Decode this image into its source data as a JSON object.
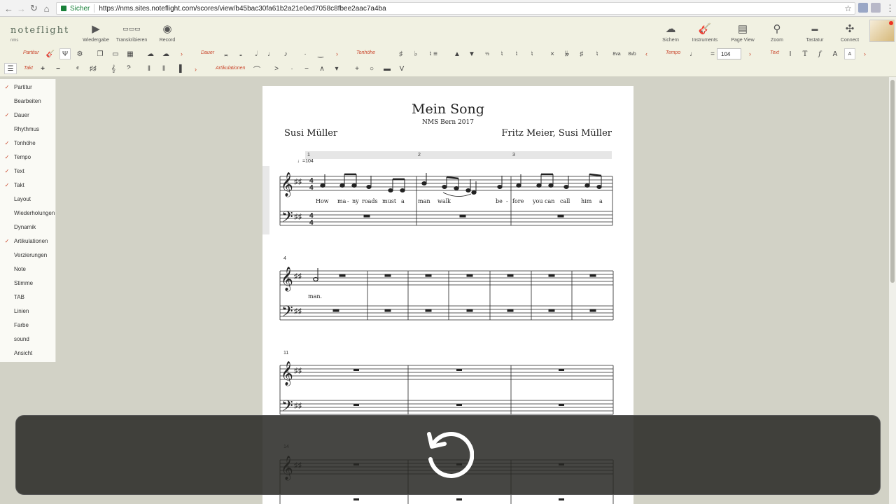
{
  "browser": {
    "secure_label": "Sicher",
    "url": "https://nms.sites.noteflight.com/scores/view/b45bac30fa61b2a21e0ed7058c8fbee2aac7a4ba"
  },
  "header": {
    "logo": "noteflight",
    "logo_sub": "nms",
    "buttons": {
      "playback": "Wiedergabe",
      "transcribe": "Transkribieren",
      "record": "Record",
      "save": "Sichern",
      "instruments": "Instruments",
      "page_view": "Page View",
      "zoom": "Zoom",
      "keyboard": "Tastatur",
      "connect": "Connect"
    }
  },
  "toolbar": {
    "labels": {
      "score": "Partitur",
      "duration": "Dauer",
      "pitch": "Tonhöhe",
      "tempo": "Tempo",
      "text": "Text",
      "measure": "Takt",
      "articulations": "Artikulationen"
    },
    "tempo_value": "104",
    "tempo_eq": "=",
    "text_tools": [
      "I",
      "T",
      "f",
      "A"
    ]
  },
  "leftmenu": {
    "items": [
      {
        "label": "Partitur",
        "checked": "✓"
      },
      {
        "label": "Bearbeiten",
        "checked": ""
      },
      {
        "label": "Dauer",
        "checked": "✓"
      },
      {
        "label": "Rhythmus",
        "checked": ""
      },
      {
        "label": "Tonhöhe",
        "checked": "✓"
      },
      {
        "label": "Tempo",
        "checked": "✓"
      },
      {
        "label": "Text",
        "checked": "✓"
      },
      {
        "label": "Takt",
        "checked": "✓"
      },
      {
        "label": "Layout",
        "checked": ""
      },
      {
        "label": "Wiederholungen",
        "checked": ""
      },
      {
        "label": "Dynamik",
        "checked": ""
      },
      {
        "label": "Artikulationen",
        "checked": "✓"
      },
      {
        "label": "Verzierungen",
        "checked": ""
      },
      {
        "label": "Note",
        "checked": ""
      },
      {
        "label": "Stimme",
        "checked": ""
      },
      {
        "label": "TAB",
        "checked": ""
      },
      {
        "label": "Linien",
        "checked": ""
      },
      {
        "label": "Farbe",
        "checked": ""
      },
      {
        "label": "sound",
        "checked": ""
      },
      {
        "label": "Ansicht",
        "checked": ""
      }
    ]
  },
  "score": {
    "title": "Mein Song",
    "subtitle": "NMS Bern 2017",
    "composer": "Susi Müller",
    "lyricist": "Fritz Meier, Susi Müller",
    "tempo_mark": "=104",
    "measure_numbers": [
      "1",
      "2",
      "3",
      "4",
      "11",
      "14"
    ],
    "lyrics": [
      "How",
      "ma",
      "-",
      "ny",
      "roads",
      "must",
      "a",
      "man",
      "walk",
      "be",
      "-",
      "fore",
      "you",
      "can",
      "call",
      "him",
      "a",
      "man."
    ]
  },
  "colors": {
    "accent": "#c9452b",
    "app_bg": "#f1f1e2",
    "workspace": "#d2d2c6"
  }
}
